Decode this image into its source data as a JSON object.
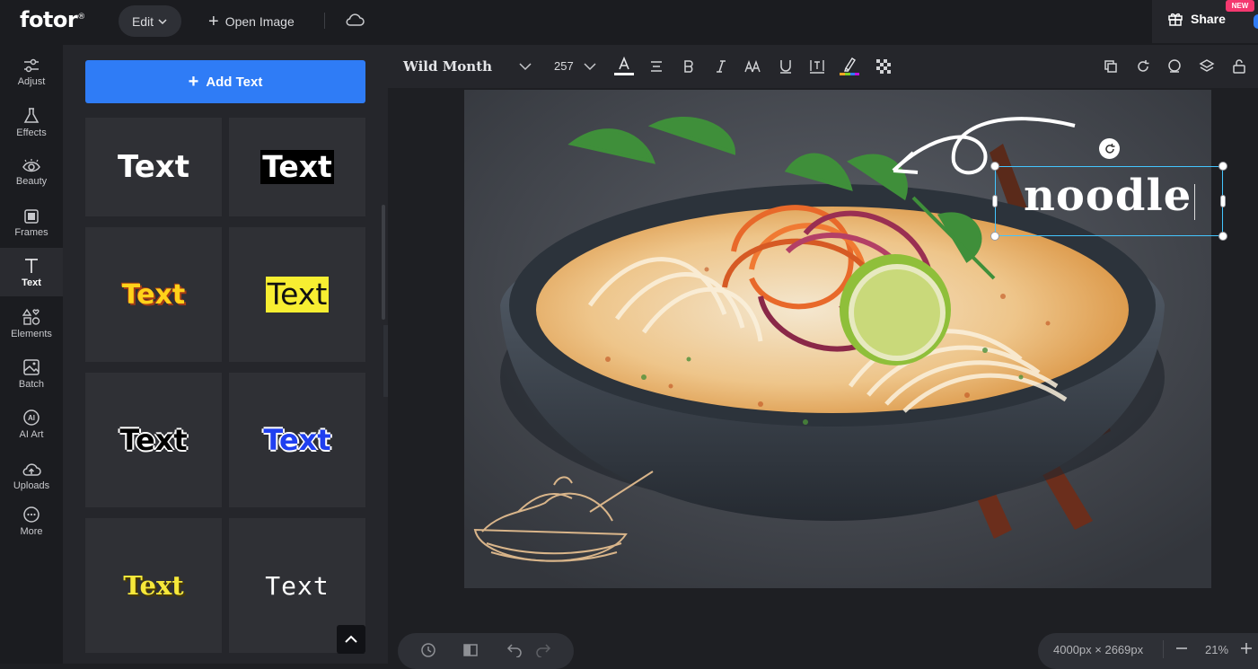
{
  "app": {
    "logo": "fotor",
    "logo_mark": "®"
  },
  "topbar": {
    "edit_label": "Edit",
    "open_image_label": "Open Image",
    "share_label": "Share",
    "new_badge": "NEW"
  },
  "sidebar": {
    "items": [
      {
        "label": "Adjust",
        "icon": "sliders-icon"
      },
      {
        "label": "Effects",
        "icon": "flask-icon"
      },
      {
        "label": "Beauty",
        "icon": "eye-icon"
      },
      {
        "label": "Frames",
        "icon": "frame-icon"
      },
      {
        "label": "Text",
        "icon": "text-icon"
      },
      {
        "label": "Elements",
        "icon": "shapes-icon"
      },
      {
        "label": "Batch",
        "icon": "images-icon"
      },
      {
        "label": "AI Art",
        "icon": "ai-icon"
      },
      {
        "label": "Uploads",
        "icon": "cloud-upload-icon"
      },
      {
        "label": "More",
        "icon": "more-icon"
      }
    ],
    "active": "Text"
  },
  "panel": {
    "add_text_label": "Add Text",
    "presets": [
      {
        "label": "Text",
        "style": "white-bold"
      },
      {
        "label": "Text",
        "style": "white-on-black"
      },
      {
        "label": "Text",
        "style": "yellow-outline"
      },
      {
        "label": "Text",
        "style": "black-on-yellow"
      },
      {
        "label": "Text",
        "style": "black-white-outline"
      },
      {
        "label": "Text",
        "style": "blue-white-outline"
      },
      {
        "label": "Text",
        "style": "yellow-serif"
      },
      {
        "label": "Text",
        "style": "pixel-white"
      }
    ]
  },
  "toolbar": {
    "font_name": "Wild Month",
    "font_size": "257"
  },
  "canvas": {
    "text_layer": "noodle",
    "image_description_colors": {
      "background": "#474b52",
      "bowl": "#3a4149",
      "soup": "#e8b66b",
      "carrot": "#e8692a",
      "onion": "#9a2f52",
      "lime": "#8fbf3a",
      "herb": "#3f8f3a",
      "chopstick": "#6b2e1c"
    }
  },
  "bottom": {
    "dimensions": "4000px × 2669px",
    "zoom": "21%"
  },
  "colors": {
    "accent": "#2f7cf6",
    "selection": "#44c6ff",
    "badge": "#f4386f"
  }
}
